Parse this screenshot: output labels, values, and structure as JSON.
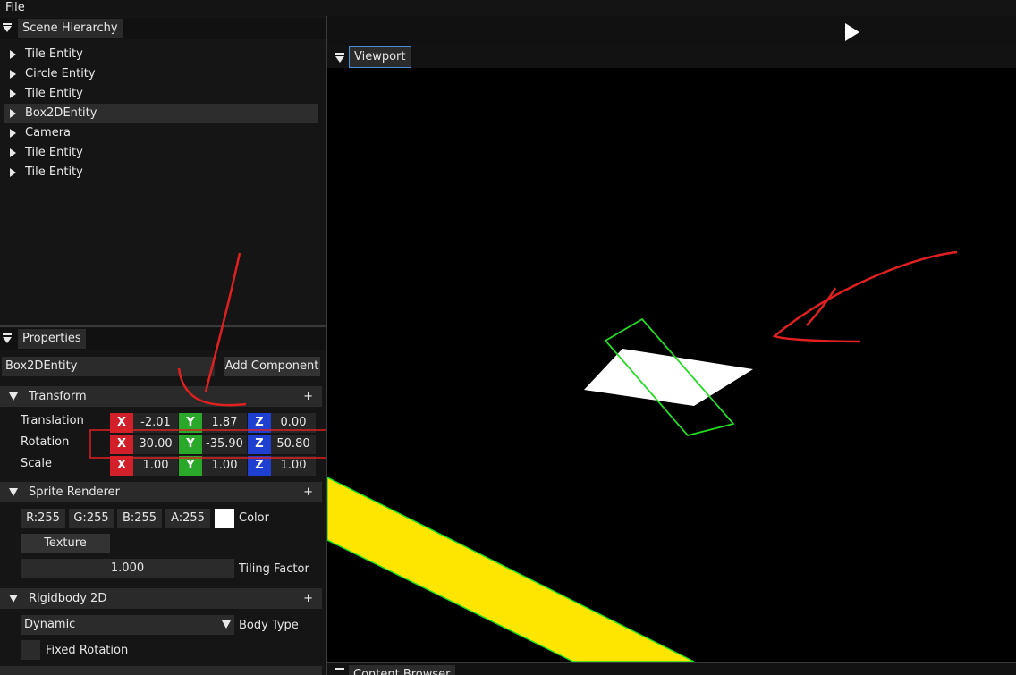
{
  "menubar": {
    "file": "File"
  },
  "scene_hierarchy": {
    "title": "Scene Hierarchy",
    "items": [
      {
        "label": "Tile Entity",
        "selected": false
      },
      {
        "label": "Circle Entity",
        "selected": false
      },
      {
        "label": "Tile Entity",
        "selected": false
      },
      {
        "label": "Box2DEntity",
        "selected": true
      },
      {
        "label": "Camera",
        "selected": false
      },
      {
        "label": "Tile Entity",
        "selected": false
      },
      {
        "label": "Tile Entity",
        "selected": false
      }
    ]
  },
  "properties": {
    "title": "Properties",
    "entity_name": "Box2DEntity",
    "add_component": "Add Component",
    "transform": {
      "title": "Transform",
      "plus": "+",
      "rows": [
        {
          "label": "Translation",
          "x": "-2.01",
          "y": "1.87",
          "z": "0.00"
        },
        {
          "label": "Rotation",
          "x": "30.00",
          "y": "-35.90",
          "z": "50.80"
        },
        {
          "label": "Scale",
          "x": "1.00",
          "y": "1.00",
          "z": "1.00"
        }
      ],
      "axis_labels": {
        "x": "X",
        "y": "Y",
        "z": "Z"
      }
    },
    "sprite_renderer": {
      "title": "Sprite Renderer",
      "plus": "+",
      "r": "R:255",
      "g": "G:255",
      "b": "B:255",
      "a": "A:255",
      "color_label": "Color",
      "swatch_color": "#ffffff",
      "texture": "Texture",
      "tiling_value": "1.000",
      "tiling_label": "Tiling Factor"
    },
    "rigidbody": {
      "title": "Rigidbody 2D",
      "plus": "+",
      "body_type_value": "Dynamic",
      "body_type_label": "Body Type",
      "fixed_rotation_label": "Fixed Rotation",
      "fixed_rotation_checked": false
    }
  },
  "viewport": {
    "title": "Viewport",
    "colors": {
      "background": "#000000",
      "sprite": "#ffffff",
      "collider_outline": "#22dd22",
      "ground": "#ffe600",
      "annotation": "#e02020"
    }
  },
  "toolbar": {
    "play_icon": "play-icon"
  },
  "content_browser": {
    "title": "Content Browser"
  },
  "colors": {
    "axis_x": "#d1202a",
    "axis_y": "#2aa82a",
    "axis_z": "#1f3fd0",
    "tab_accent": "#4a90d9"
  }
}
